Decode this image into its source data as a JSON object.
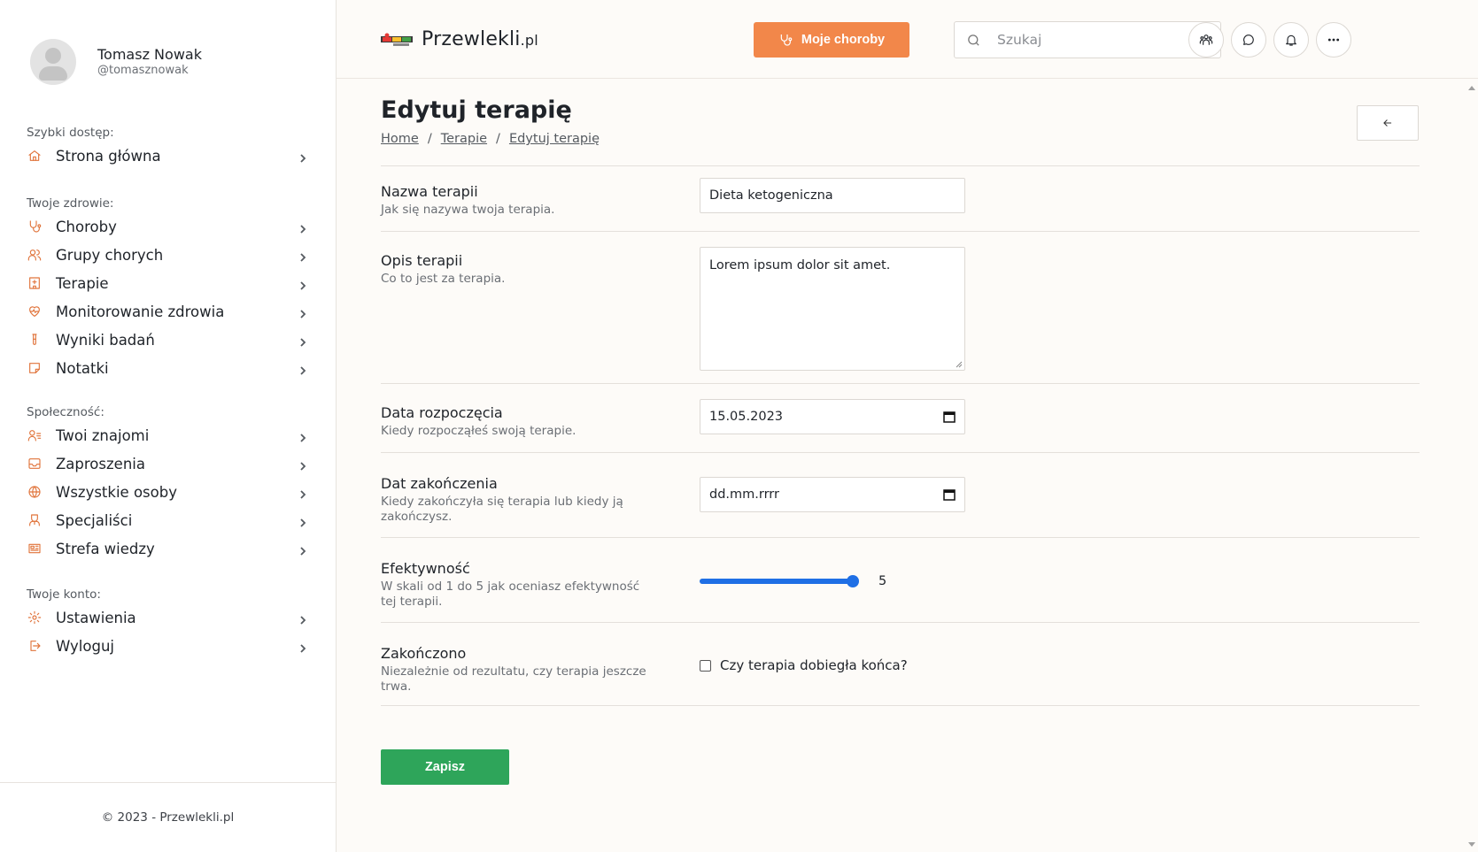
{
  "user": {
    "name": "Tomasz Nowak",
    "handle": "@tomasznowak"
  },
  "sidebar": {
    "sections": [
      {
        "heading": "Szybki dostęp:",
        "items": [
          {
            "label": "Strona główna",
            "icon": "home-icon"
          }
        ]
      },
      {
        "heading": "Twoje zdrowie:",
        "items": [
          {
            "label": "Choroby",
            "icon": "stethoscope-icon"
          },
          {
            "label": "Grupy chorych",
            "icon": "users-icon"
          },
          {
            "label": "Terapie",
            "icon": "hospital-icon"
          },
          {
            "label": "Monitorowanie zdrowia",
            "icon": "heart-pulse-icon"
          },
          {
            "label": "Wyniki badań",
            "icon": "test-tube-icon"
          },
          {
            "label": "Notatki",
            "icon": "note-icon"
          }
        ]
      },
      {
        "heading": "Społeczność:",
        "items": [
          {
            "label": "Twoi znajomi",
            "icon": "user-list-icon"
          },
          {
            "label": "Zaproszenia",
            "icon": "inbox-icon"
          },
          {
            "label": "Wszystkie osoby",
            "icon": "globe-icon"
          },
          {
            "label": "Specjaliści",
            "icon": "doctor-icon"
          },
          {
            "label": "Strefa wiedzy",
            "icon": "newspaper-icon"
          }
        ]
      },
      {
        "heading": "Twoje konto:",
        "items": [
          {
            "label": "Ustawienia",
            "icon": "gear-icon"
          },
          {
            "label": "Wyloguj",
            "icon": "logout-icon"
          }
        ]
      }
    ],
    "footer": "© 2023 - Przewlekli.pl"
  },
  "header": {
    "logo_main": "Przewlekli",
    "logo_suffix": ".pl",
    "diseases_button": "Moje choroby",
    "search_placeholder": "Szukaj"
  },
  "page": {
    "title": "Edytuj terapię",
    "breadcrumb": [
      "Home",
      "Terapie",
      "Edytuj terapię"
    ]
  },
  "form": {
    "name": {
      "label": "Nazwa terapii",
      "help": "Jak się nazywa twoja terapia.",
      "value": "Dieta ketogeniczna"
    },
    "description": {
      "label": "Opis terapii",
      "help": "Co to jest za terapia.",
      "value": "Lorem ipsum dolor sit amet."
    },
    "start_date": {
      "label": "Data rozpoczęcia",
      "help": "Kiedy rozpocząłeś swoją terapie.",
      "value": "15.05.2023"
    },
    "end_date": {
      "label": "Dat zakończenia",
      "help": "Kiedy zakończyła się terapia lub kiedy ją zakończysz.",
      "value": "dd.mm.rrrr"
    },
    "effectiveness": {
      "label": "Efektywność",
      "help": "W skali od 1 do 5 jak oceniasz efektywność tej terapii.",
      "value": 5,
      "min": 1,
      "max": 5
    },
    "finished": {
      "label": "Zakończono",
      "help": "Niezależnie od rezultatu, czy terapia jeszcze trwa.",
      "checkbox_label": "Czy terapia dobiegła końca?",
      "checked": false
    },
    "save_label": "Zapisz"
  },
  "colors": {
    "accent": "#f2874a",
    "icon": "#e0733a",
    "save": "#2ea55a",
    "slider": "#1f6fe5"
  }
}
